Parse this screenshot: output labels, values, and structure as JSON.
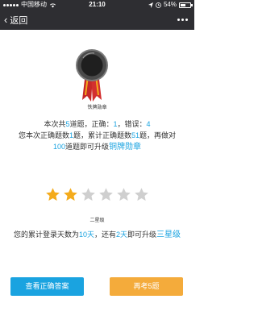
{
  "status_bar": {
    "carrier": "中国移动",
    "time": "21:10",
    "battery": "54%",
    "battery_level": 0.54
  },
  "nav": {
    "back_label": "返回"
  },
  "medal": {
    "name": "铁牌勋章"
  },
  "summary": {
    "line1_prefix": "本次共",
    "total": "5",
    "line1_mid1": "道题，正确：",
    "correct": "1",
    "line1_mid2": "，错误：",
    "wrong": "4",
    "line2_prefix": "您本次正确题数",
    "this_correct": "1",
    "line2_mid": "题，累计正确题数",
    "cumulative_correct": "51",
    "line2_suffix": "题，再做对",
    "needed": "100",
    "line3_mid": "道题即可升级",
    "next_medal": "铜牌勋章"
  },
  "stars": {
    "filled": 2,
    "total": 6,
    "level_label": "二星级"
  },
  "login": {
    "prefix": "您的累计登录天数为",
    "days": "10天",
    "mid": "，还有",
    "remaining": "2天",
    "suffix": "即可升级",
    "next_level": "三星级"
  },
  "buttons": {
    "view_answers": "查看正确答案",
    "retake": "再考5题"
  },
  "colors": {
    "bar": "#2e2e32",
    "accent_blue": "#1aa3e0",
    "accent_orange": "#f4ab3b",
    "star_on": "#f4ab1c",
    "star_off": "#cfcfcf"
  }
}
